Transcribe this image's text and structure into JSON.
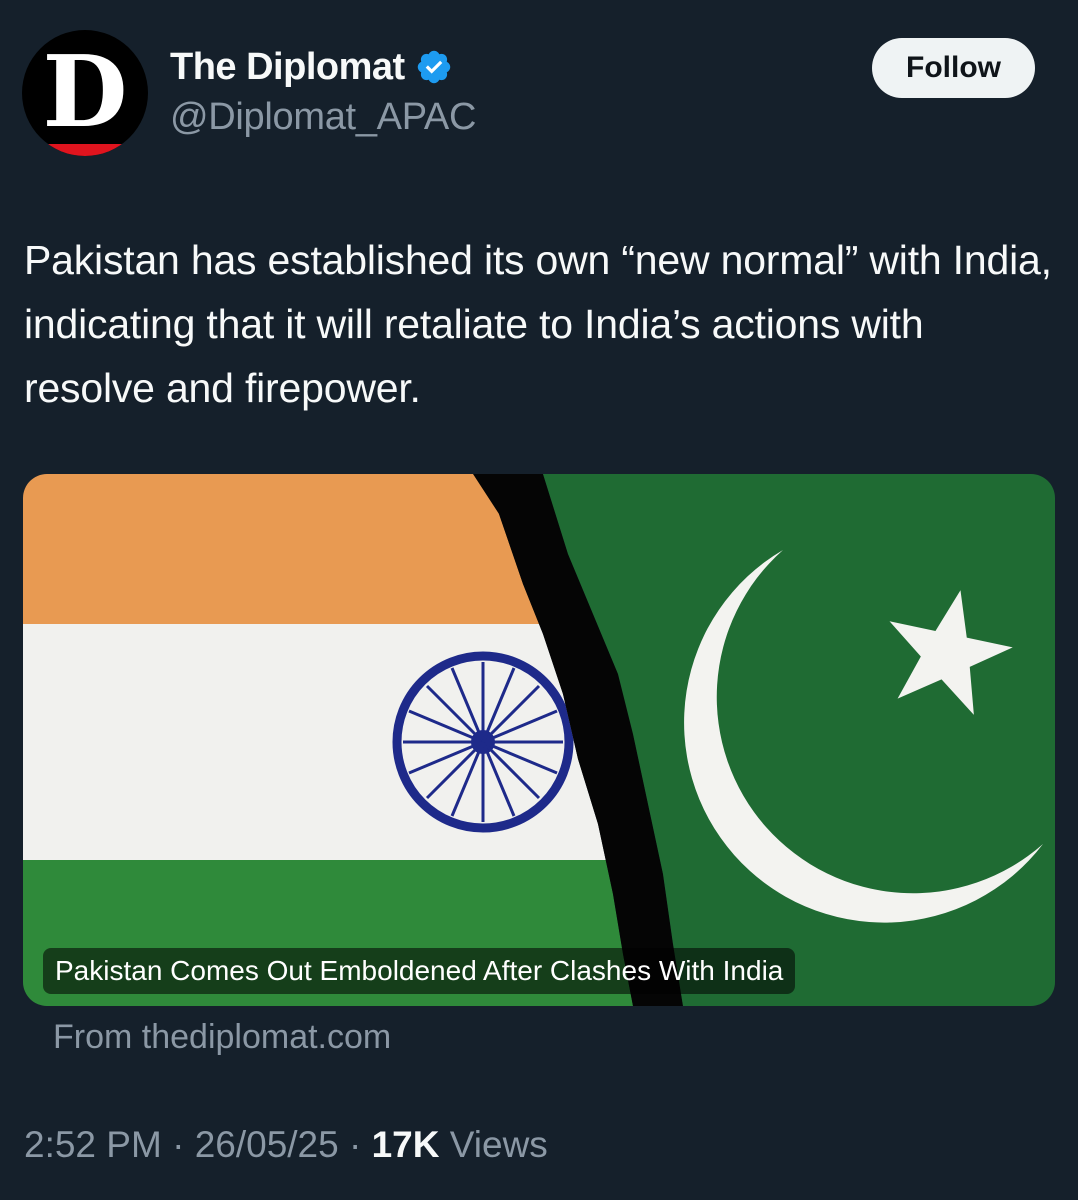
{
  "author": {
    "avatar_letter": "D",
    "display_name": "The Diplomat",
    "handle": "@Diplomat_APAC",
    "verified_icon": "verified-badge-icon"
  },
  "follow_label": "Follow",
  "tweet_text": "Pakistan has established its own “new normal” with India, indicating that it will retaliate to India’s actions with resolve and firepower.",
  "card": {
    "image_icon": "india-pakistan-flags-torn",
    "headline": "Pakistan Comes Out Emboldened After Clashes With India",
    "source": "From thediplomat.com"
  },
  "meta": {
    "time": "2:52 PM",
    "separator": "·",
    "date": "26/05/25",
    "views_count": "17K",
    "views_label": "Views"
  },
  "colors": {
    "background": "#15202b",
    "brand_red": "#e0141e",
    "verified_blue": "#1d9bf0",
    "saffron": "#e89a52",
    "india_green": "#2f8a3a",
    "pakistan_green": "#1f6b33",
    "chakra_blue": "#1e2a8a"
  }
}
